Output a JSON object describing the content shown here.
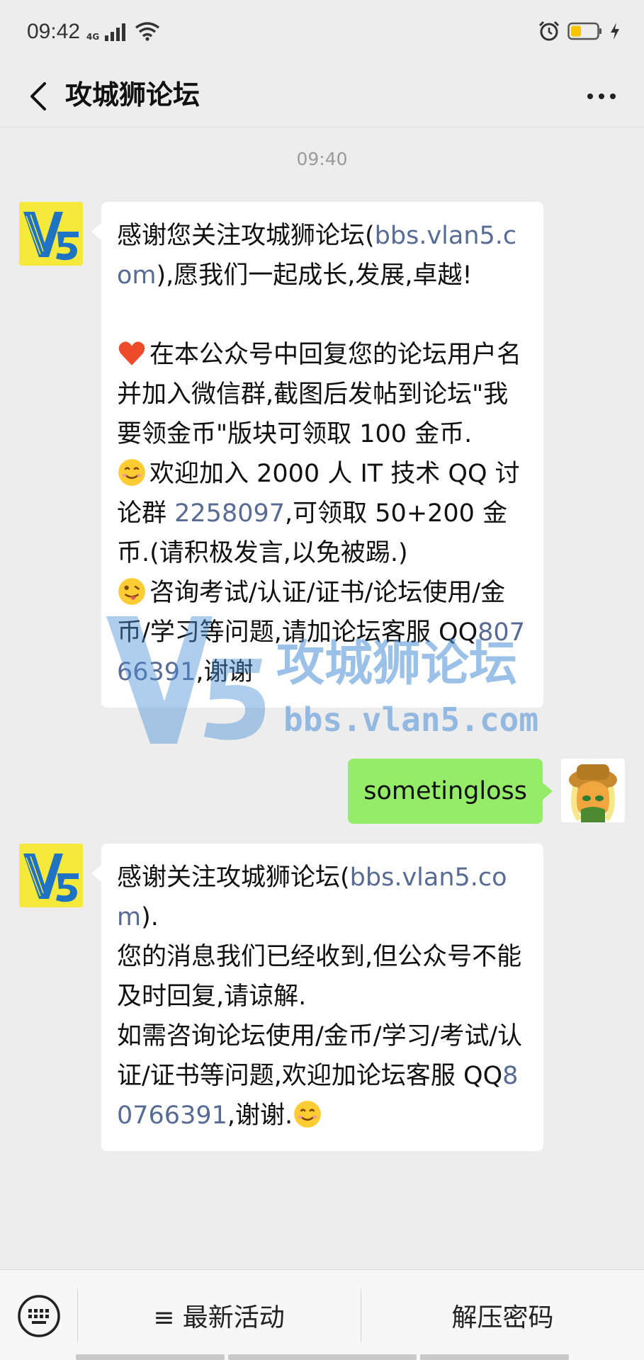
{
  "status_bar": {
    "time": "09:42",
    "network": "4G"
  },
  "header": {
    "title": "攻城狮论坛"
  },
  "chat": {
    "timestamp": "09:40",
    "messages": [
      {
        "sender": "official",
        "paragraphs": [
          {
            "parts": [
              {
                "t": "感谢您关注攻城狮论坛("
              },
              {
                "t": "bbs.vlan5.com",
                "link": true
              },
              {
                "t": "),愿我们一起成长,发展,卓越!"
              }
            ]
          },
          {
            "parts": [
              {
                "t": ""
              }
            ]
          },
          {
            "parts": [
              {
                "emoji": "heart"
              },
              {
                "t": "在本公众号中回复您的论坛用户名并加入微信群,截图后发帖到论坛\"我要领金币\"版块可领取 100 金币."
              }
            ]
          },
          {
            "parts": [
              {
                "emoji": "smile"
              },
              {
                "t": "欢迎加入 2000 人 IT 技术 QQ 讨论群 "
              },
              {
                "t": "2258097",
                "link": true
              },
              {
                "t": ",可领取 50+200 金币.(请积极发言,以免被踢.)"
              }
            ]
          },
          {
            "parts": [
              {
                "emoji": "tongue"
              },
              {
                "t": "咨询考试/认证/证书/论坛使用/金币/学习等问题,请加论坛客服 QQ"
              },
              {
                "t": "80766391",
                "link": true
              },
              {
                "t": ",谢谢"
              }
            ]
          }
        ]
      },
      {
        "sender": "me",
        "text": "sometingloss"
      },
      {
        "sender": "official",
        "paragraphs": [
          {
            "parts": [
              {
                "t": "感谢关注攻城狮论坛("
              },
              {
                "t": "bbs.vlan5.com",
                "link": true
              },
              {
                "t": ")."
              }
            ]
          },
          {
            "parts": [
              {
                "t": "您的消息我们已经收到,但公众号不能及时回复,请谅解."
              }
            ]
          },
          {
            "parts": [
              {
                "t": "如需咨询论坛使用/金币/学习/考试/认证/证书等问题,欢迎加论坛客服 QQ"
              },
              {
                "t": "80766391",
                "link": true
              },
              {
                "t": ",谢谢."
              },
              {
                "emoji": "smile"
              }
            ]
          }
        ]
      }
    ],
    "watermark": {
      "brand": "V5",
      "name": "攻城狮论坛",
      "url": "bbs.vlan5.com"
    }
  },
  "bottom_menu": {
    "items": [
      "≡ 最新活动",
      "解压密码"
    ]
  },
  "colors": {
    "link": "#576b95",
    "bubble_green": "#95ec69",
    "background": "#ededed",
    "avatar_yellow": "#f5ea3c"
  }
}
